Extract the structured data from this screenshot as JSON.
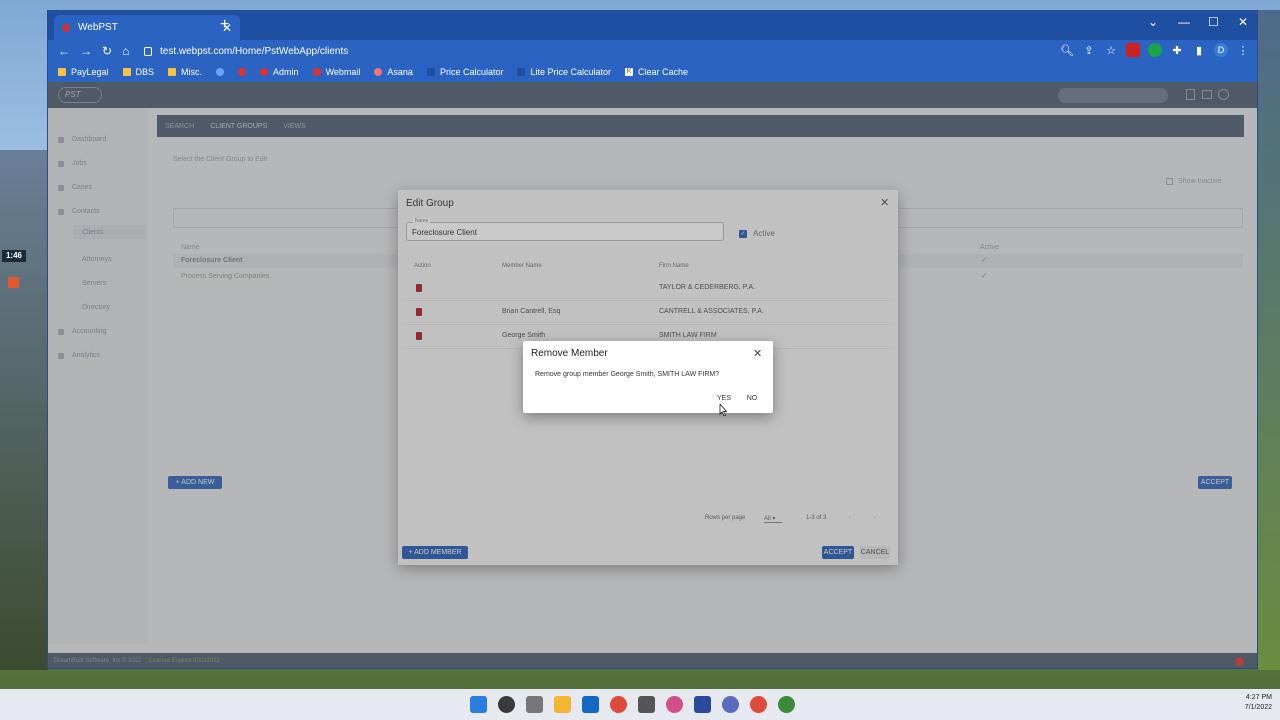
{
  "recorder": {
    "time": "1:46"
  },
  "browser": {
    "tab_title": "WebPST",
    "url": "test.webpst.com/Home/PstWebApp/clients",
    "profile_initial": "D",
    "bookmarks": [
      "PayLegal",
      "DBS",
      "Misc.",
      "Admin",
      "Webmail",
      "Asana",
      "Price Calculator",
      "Lite Price Calculator",
      "Clear Cache"
    ]
  },
  "app": {
    "logo": "PST",
    "sidebar": [
      "Dashboard",
      "Jobs",
      "Cases",
      "Contacts",
      "Clients",
      "Attorneys",
      "Servers",
      "Directory",
      "Accounting",
      "Analytics"
    ],
    "subnav": [
      "SEARCH",
      "CLIENT GROUPS",
      "VIEWS"
    ],
    "select_text": "Select the Client Group to Edit",
    "show_inactive": "Show Inactive",
    "list_header_name": "Name",
    "list_header_active": "Active",
    "groups": [
      "Foreclosure Client",
      "Process Serving Companies"
    ],
    "add_new": "ADD NEW",
    "accept": "ACCEPT",
    "footer": "DreamBuilt Software, Inc © 2022",
    "license": "License Expires 8/10/2022"
  },
  "edit_group": {
    "title": "Edit Group",
    "name_label": "Name",
    "name_value": "Foreclosure Client",
    "active_label": "Active",
    "headers": {
      "action": "Action",
      "member": "Member Name",
      "firm": "Firm Name"
    },
    "members": [
      {
        "member": "",
        "firm": "TAYLOR & CEDERBERG, P.A."
      },
      {
        "member": "Brian Cantrell, Esq",
        "firm": "CANTRELL & ASSOCIATES, P.A."
      },
      {
        "member": "George Smith",
        "firm": "SMITH LAW FIRM"
      }
    ],
    "rows_per_page_label": "Rows per page",
    "rows_per_page_value": "All",
    "range": "1-3 of 3",
    "add_member": "ADD MEMBER",
    "accept": "ACCEPT",
    "cancel": "CANCEL"
  },
  "remove_member": {
    "title": "Remove Member",
    "message": "Remove group member George Smith, SMITH LAW FIRM?",
    "yes": "YES",
    "no": "NO"
  },
  "taskbar": {
    "time": "4:27 PM",
    "date": "7/1/2022"
  }
}
